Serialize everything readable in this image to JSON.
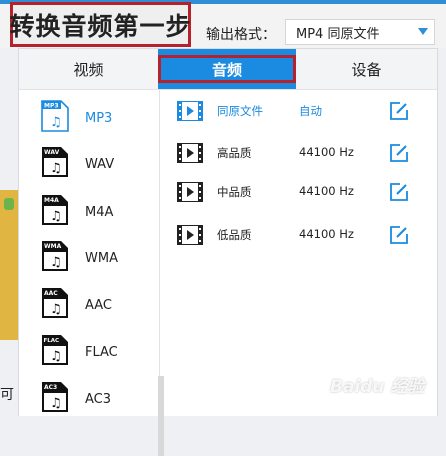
{
  "header": {
    "title": "转换音频第一步",
    "format_label": "输出格式：",
    "format_value": "MP4  同原文件"
  },
  "tabs": [
    {
      "label": "视频",
      "active": false
    },
    {
      "label": "音频",
      "active": true
    },
    {
      "label": "设备",
      "active": false
    }
  ],
  "formats": [
    {
      "badge": "MP3",
      "label": "MP3",
      "selected": true
    },
    {
      "badge": "WAV",
      "label": "WAV",
      "selected": false
    },
    {
      "badge": "M4A",
      "label": "M4A",
      "selected": false
    },
    {
      "badge": "WMA",
      "label": "WMA",
      "selected": false
    },
    {
      "badge": "AAC",
      "label": "AAC",
      "selected": false
    },
    {
      "badge": "FLAC",
      "label": "FLAC",
      "selected": false
    },
    {
      "badge": "AC3",
      "label": "AC3",
      "selected": false
    }
  ],
  "qualities": [
    {
      "name": "同原文件",
      "rate": "自动",
      "selected": true
    },
    {
      "name": "高品质",
      "rate": "44100 Hz",
      "selected": false
    },
    {
      "name": "中品质",
      "rate": "44100 Hz",
      "selected": false
    },
    {
      "name": "低品质",
      "rate": "44100 Hz",
      "selected": false
    }
  ],
  "side_text": "可",
  "watermark": "Baidu 经验",
  "colors": {
    "accent": "#1a8be0",
    "highlight_border": "#b5222b"
  }
}
